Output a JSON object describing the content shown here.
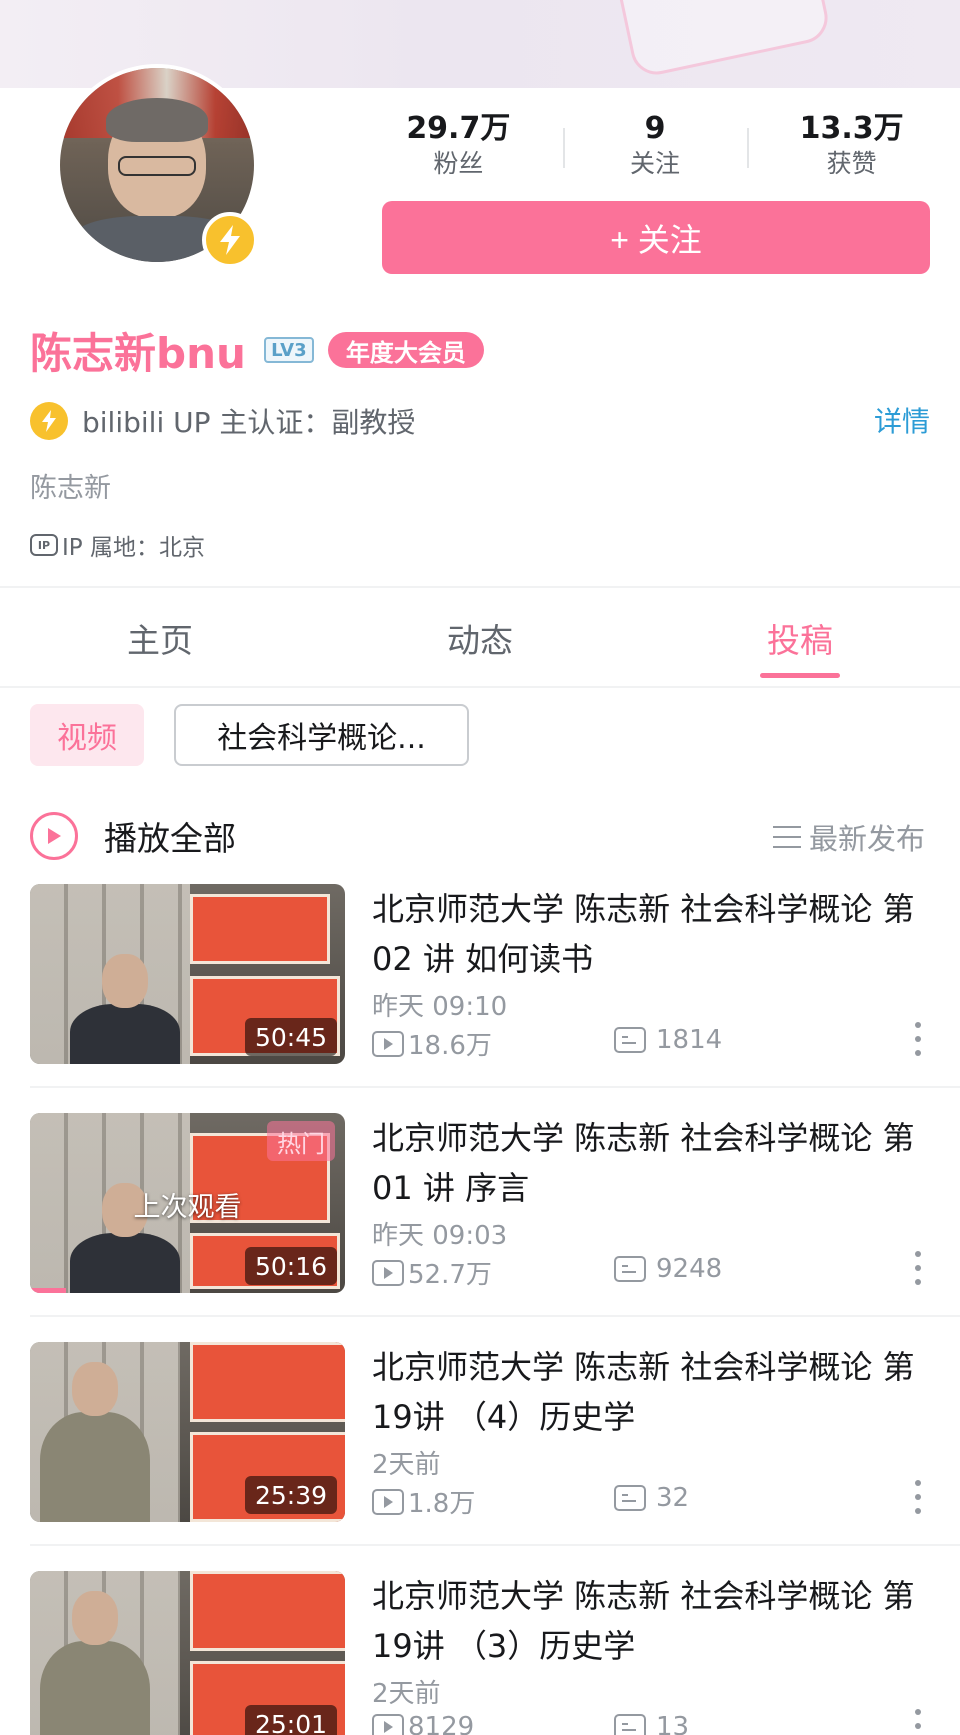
{
  "profile": {
    "followers_count": "29.7万",
    "followers_label": "粉丝",
    "following_count": "9",
    "following_label": "关注",
    "likes_count": "13.3万",
    "likes_label": "获赞",
    "follow_button": "+ 关注",
    "name": "陈志新bnu",
    "level": "LV3",
    "vip_badge": "年度大会员",
    "verify_text": "bilibili UP 主认证：副教授",
    "details_link": "详情",
    "signature": "陈志新",
    "ip_icon": "IP",
    "ip_location": "IP 属地：北京"
  },
  "tabs": [
    {
      "label": "主页",
      "active": false
    },
    {
      "label": "动态",
      "active": false
    },
    {
      "label": "投稿",
      "active": true
    }
  ],
  "filters": {
    "video_chip": "视频",
    "series_chip": "社会科学概论..."
  },
  "play_all": {
    "label": "播放全部",
    "sort_label": "最新发布"
  },
  "videos": [
    {
      "title": "北京师范大学 陈志新 社会科学概论 第 02 讲 如何读书",
      "time": "昨天 09:10",
      "views": "18.6万",
      "danmaku": "1814",
      "duration": "50:45"
    },
    {
      "title": "北京师范大学 陈志新 社会科学概论 第 01 讲 序言",
      "time": "昨天 09:03",
      "views": "52.7万",
      "danmaku": "9248",
      "duration": "50:16",
      "hot_badge": "热门",
      "last_watched": "上次观看"
    },
    {
      "title": "北京师范大学 陈志新 社会科学概论 第19讲 （4）历史学",
      "time": "2天前",
      "views": "1.8万",
      "danmaku": "32",
      "duration": "25:39"
    },
    {
      "title": "北京师范大学 陈志新 社会科学概论 第19讲 （3）历史学",
      "time": "2天前",
      "views": "8129",
      "danmaku": "13",
      "duration": "25:01"
    }
  ],
  "colors": {
    "accent": "#fb7299",
    "link": "#2c9cd6",
    "bolt": "#f8c12d",
    "muted_text": "#9499a0"
  }
}
